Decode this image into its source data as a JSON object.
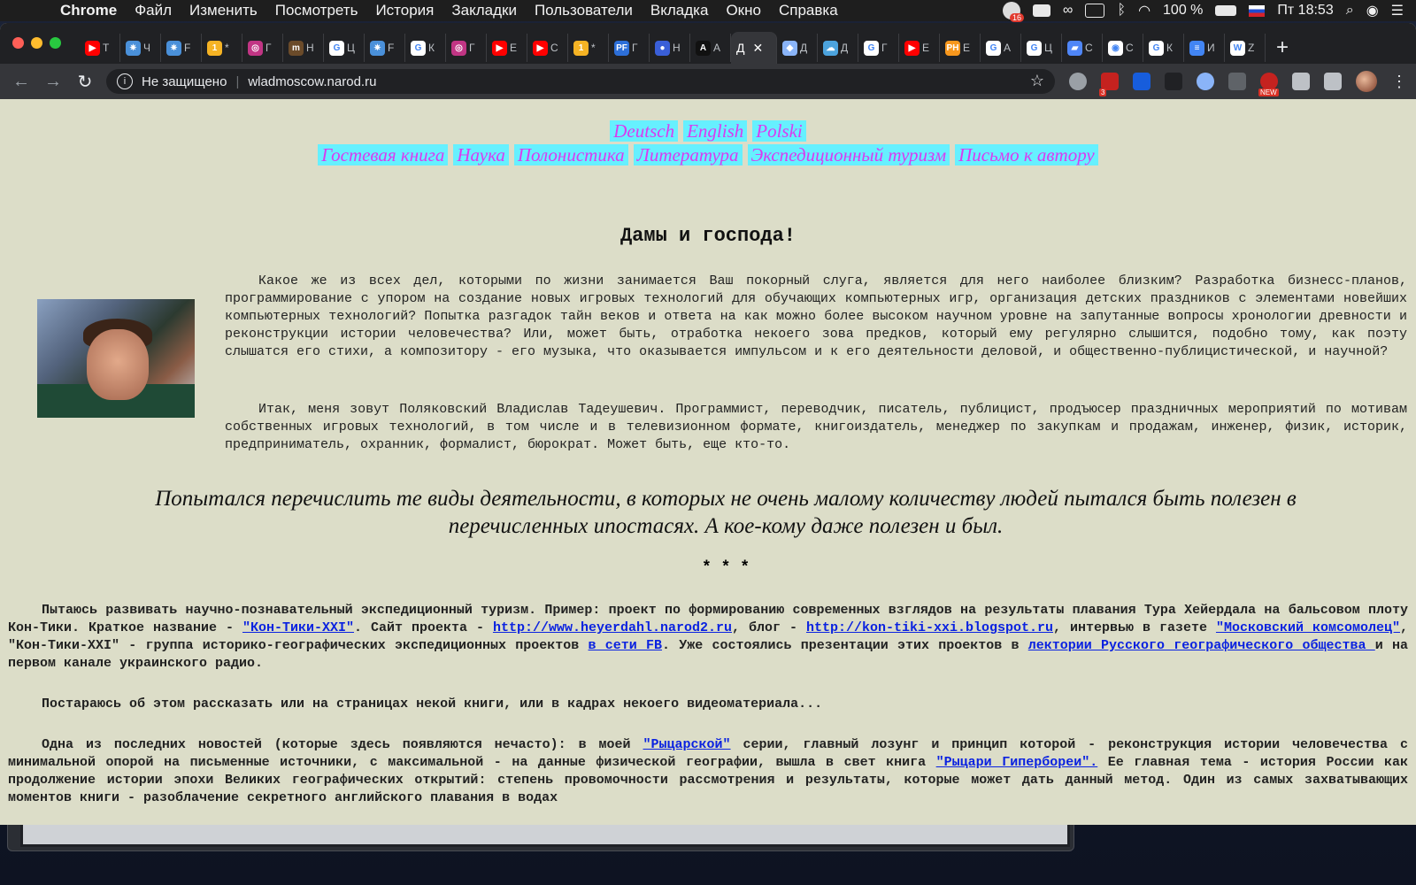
{
  "menubar": {
    "app": "Chrome",
    "items": [
      "Файл",
      "Изменить",
      "Посмотреть",
      "История",
      "Закладки",
      "Пользователи",
      "Вкладка",
      "Окно",
      "Справка"
    ],
    "notif_count": "16",
    "battery": "100 %",
    "clock": "Пт 18:53"
  },
  "tabs": [
    {
      "icon": "youtube-icon",
      "label": "Т",
      "color": "#ff0000",
      "glyph": "▶"
    },
    {
      "icon": "star-app-icon",
      "label": "Ч",
      "color": "#4a90d9",
      "glyph": "✷"
    },
    {
      "icon": "star-app-icon",
      "label": "F",
      "color": "#4a90d9",
      "glyph": "✷"
    },
    {
      "icon": "mail-icon",
      "label": "*",
      "color": "#f5b324",
      "glyph": "1"
    },
    {
      "icon": "instagram-icon",
      "label": "Г",
      "color": "#c13584",
      "glyph": "◎"
    },
    {
      "icon": "m-icon",
      "label": "Н",
      "color": "#6b4b2a",
      "glyph": "m"
    },
    {
      "icon": "google-icon",
      "label": "Ц",
      "color": "#ffffff",
      "glyph": "G"
    },
    {
      "icon": "star-app-icon",
      "label": "F",
      "color": "#4a90d9",
      "glyph": "✷"
    },
    {
      "icon": "google-icon",
      "label": "К",
      "color": "#ffffff",
      "glyph": "G"
    },
    {
      "icon": "instagram-icon",
      "label": "Г",
      "color": "#c13584",
      "glyph": "◎"
    },
    {
      "icon": "youtube-icon",
      "label": "Е",
      "color": "#ff0000",
      "glyph": "▶"
    },
    {
      "icon": "youtube-icon",
      "label": "С",
      "color": "#ff0000",
      "glyph": "▶"
    },
    {
      "icon": "mail-icon",
      "label": "*",
      "color": "#f5b324",
      "glyph": "1"
    },
    {
      "icon": "pf-icon",
      "label": "Г",
      "color": "#2d6fd8",
      "glyph": "PF"
    },
    {
      "icon": "circle-icon",
      "label": "Н",
      "color": "#3a5fd8",
      "glyph": "●"
    },
    {
      "icon": "a-icon",
      "label": "А",
      "color": "#111111",
      "glyph": "A"
    },
    {
      "icon": "page-icon",
      "label": "Д",
      "color": "#35363a",
      "glyph": "Д",
      "active": true
    },
    {
      "icon": "shield-icon",
      "label": "Д",
      "color": "#8ab4f8",
      "glyph": "◆"
    },
    {
      "icon": "cloud-icon",
      "label": "Д",
      "color": "#4ca3dd",
      "glyph": "☁"
    },
    {
      "icon": "google-icon",
      "label": "Г",
      "color": "#ffffff",
      "glyph": "G"
    },
    {
      "icon": "youtube-icon",
      "label": "Е",
      "color": "#ff0000",
      "glyph": "▶"
    },
    {
      "icon": "ph-icon",
      "label": "Е",
      "color": "#f7971d",
      "glyph": "PH"
    },
    {
      "icon": "google-icon",
      "label": "А",
      "color": "#ffffff",
      "glyph": "G"
    },
    {
      "icon": "google-icon",
      "label": "Ц",
      "color": "#ffffff",
      "glyph": "G"
    },
    {
      "icon": "chat-icon",
      "label": "С",
      "color": "#4f86f7",
      "glyph": "▰"
    },
    {
      "icon": "target-icon",
      "label": "С",
      "color": "#ffffff",
      "glyph": "◉"
    },
    {
      "icon": "google-icon",
      "label": "К",
      "color": "#ffffff",
      "glyph": "G"
    },
    {
      "icon": "docs-icon",
      "label": "И",
      "color": "#4285f4",
      "glyph": "≡"
    },
    {
      "icon": "wiki-icon",
      "label": "Z",
      "color": "#ffffff",
      "glyph": "W"
    }
  ],
  "omnibox": {
    "security": "Не защищено",
    "url": "wladmoscow.narod.ru"
  },
  "extensions": {
    "abp_count": "3",
    "new_badge": "NEW"
  },
  "nav": {
    "langs": [
      "Deutsch",
      "English",
      "Polski"
    ],
    "sections": [
      "Гостевая книга",
      "Наука ",
      "Полонистика",
      "Литература",
      "Экспедиционный туризм",
      "Письмо к автору "
    ]
  },
  "content": {
    "title": "Дамы и господа!",
    "para1": "Какое же из всех дел, которыми по жизни занимается Ваш покорный слуга, является для него наиболее близким? Разработка бизнесс-планов, программирование с упором на создание новых игровых технологий для обучающих компьютерных игр, организация детских праздников с элементами новейших компьютерных технологий? Попытка разгадок тайн веков и ответа на как можно более высоком научном уровне на запутанные вопросы хронологии древности и реконструкции истории человечества? Или, может быть, отработка некоего зова предков, который ему регулярно слышится, подобно тому, как поэту слышатся его стихи, а композитору - его музыка, что оказывается импульсом и к его деятельности деловой, и общественно-публицистической, и научной?",
    "para2": "Итак, меня зовут Поляковский Владислав Тадеушевич. Программист, переводчик, писатель, публицист, продъюсер праздничных мероприятий по мотивам собственных игровых технологий, в том числе и в телевизионном формате, книгоиздатель, менеджер по закупкам и продажам, инженер, физик, историк, предприниматель, охранник, формалист, бюрократ. Может быть, еще кто-то.",
    "quote": "Попытался перечислить те виды деятельности, в которых не очень малому количеству людей пытался быть полезен в перечисленных ипостасях. А кое-кому даже полезен и был.",
    "stars": "* * *",
    "b1": {
      "t1": "Пытаюсь развивать научно-познавательный экспедиционный туризм. Пример: проект по формированию современных взглядов на результаты плавания Тура Хейердала на бальсовом плоту Кон-Тики. Краткое название - ",
      "l1": "\"Кон-Тики-XXI\"",
      "t2": ". Сайт проекта - ",
      "l2": "http://www.heyerdahl.narod2.ru",
      "t3": ", блог - ",
      "l3": "http://kon-tiki-xxi.blogspot.ru",
      "t4": ", интервью в газете ",
      "l4": "\"Московский комсомолец\"",
      "t5": ", \"Кон-Тики-XXI\" - группа историко-географических экспедиционных проектов ",
      "l5": "в сети FB",
      "t6": ". Уже состоялись презентации этих проектов в ",
      "l6": "лектории Русского географического общества ",
      "t7": "и на первом канале украинского радио."
    },
    "b2": "Постараюсь об этом рассказать или на страницах некой книги, или в кадрах некоего видеоматериала...",
    "b3": {
      "t1": "Одна из последних новостей (которые здесь появляются нечасто): в моей ",
      "l1": "\"Рыцарской\"",
      "t2": " серии, главный лозунг и принцип которой - реконструкция истории человечества с минимальной опорой на письменные источники, с максимальной - на данные физической географии, вышла в свет книга ",
      "l2": "\"Рыцари Гипербореи\".",
      "t3": " Ее главная тема - история России как продолжение истории эпохи Великих географических открытий: степень провомочности рассмотрения и результаты, которые может дать данный метод. Один из самых захватывающих моментов книги - разоблачение секретного английского плавания в водах"
    }
  }
}
